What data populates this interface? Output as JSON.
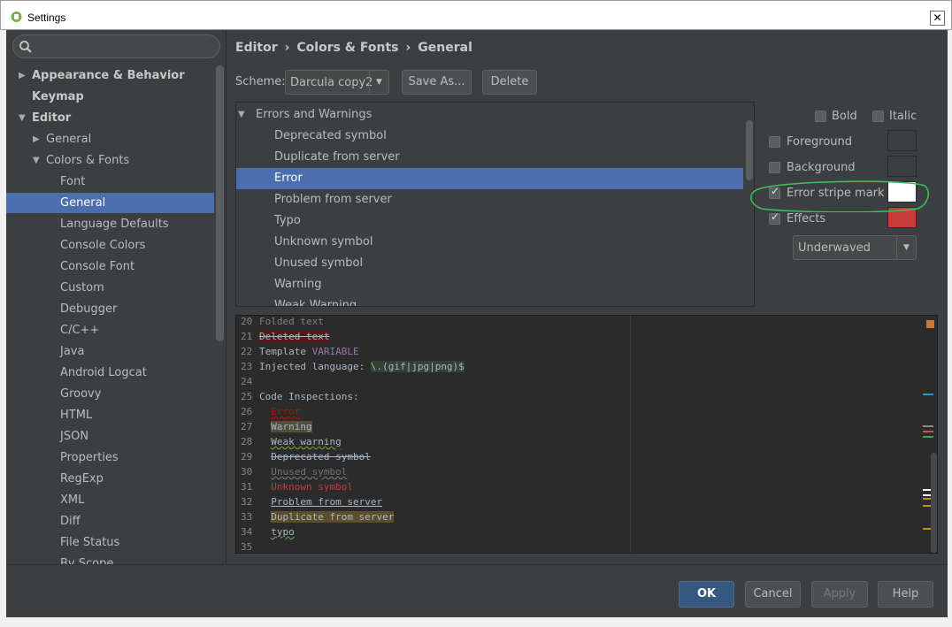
{
  "window": {
    "title": "Settings",
    "close_label": "✕"
  },
  "search": {
    "placeholder": ""
  },
  "tree": [
    {
      "label": "Appearance & Behavior",
      "arrow": "▶",
      "bold": true
    },
    {
      "label": "Keymap",
      "arrow": "",
      "bold": true
    },
    {
      "label": "Editor",
      "arrow": "▼",
      "bold": true
    },
    {
      "label": "General",
      "arrow": "▶"
    },
    {
      "label": "Colors & Fonts",
      "arrow": "▼"
    },
    {
      "label": "Font",
      "arrow": ""
    },
    {
      "label": "General",
      "arrow": "",
      "selected": true
    },
    {
      "label": "Language Defaults",
      "arrow": ""
    },
    {
      "label": "Console Colors",
      "arrow": ""
    },
    {
      "label": "Console Font",
      "arrow": ""
    },
    {
      "label": "Custom",
      "arrow": ""
    },
    {
      "label": "Debugger",
      "arrow": ""
    },
    {
      "label": "C/C++",
      "arrow": ""
    },
    {
      "label": "Java",
      "arrow": ""
    },
    {
      "label": "Android Logcat",
      "arrow": ""
    },
    {
      "label": "Groovy",
      "arrow": ""
    },
    {
      "label": "HTML",
      "arrow": ""
    },
    {
      "label": "JSON",
      "arrow": ""
    },
    {
      "label": "Properties",
      "arrow": ""
    },
    {
      "label": "RegExp",
      "arrow": ""
    },
    {
      "label": "XML",
      "arrow": ""
    },
    {
      "label": "Diff",
      "arrow": ""
    },
    {
      "label": "File Status",
      "arrow": ""
    },
    {
      "label": "By Scope",
      "arrow": ""
    }
  ],
  "breadcrumb": {
    "part1": "Editor",
    "sep": "›",
    "part2": "Colors & Fonts",
    "part3": "General"
  },
  "scheme": {
    "label": "Scheme:",
    "value": "Darcula copy2",
    "save_as": "Save As...",
    "delete": "Delete"
  },
  "attributes": {
    "group": "Errors and Warnings",
    "items": [
      "Deprecated symbol",
      "Duplicate from server",
      "Error",
      "Problem from server",
      "Typo",
      "Unknown symbol",
      "Unused symbol",
      "Warning",
      "Weak Warning"
    ],
    "selected": "Error"
  },
  "properties": {
    "bold": {
      "label": "Bold",
      "checked": false
    },
    "italic": {
      "label": "Italic",
      "checked": false
    },
    "foreground": {
      "label": "Foreground",
      "checked": false
    },
    "background": {
      "label": "Background",
      "checked": false
    },
    "error_stripe": {
      "label": "Error stripe mark",
      "checked": true,
      "color": "#ffffff"
    },
    "effects": {
      "label": "Effects",
      "checked": true,
      "color": "#c93b3b"
    },
    "effect_type": "Underwaved"
  },
  "preview": {
    "lines": [
      {
        "num": "20",
        "text": "Folded text"
      },
      {
        "num": "21",
        "text": "Deleted text"
      },
      {
        "num": "22",
        "text": "Template ",
        "var": "VARIABLE"
      },
      {
        "num": "23",
        "text": "Injected language: ",
        "inj": "\\.(gif|jpg|png)$"
      },
      {
        "num": "24",
        "text": ""
      },
      {
        "num": "25",
        "text": "Code Inspections:"
      },
      {
        "num": "26",
        "text": "  Error"
      },
      {
        "num": "27",
        "text": "  Warning"
      },
      {
        "num": "28",
        "text": "  Weak warning"
      },
      {
        "num": "29",
        "text": "  Deprecated symbol"
      },
      {
        "num": "30",
        "text": "  Unused symbol"
      },
      {
        "num": "31",
        "text": "  Unknown symbol"
      },
      {
        "num": "32",
        "text": "  Problem from server"
      },
      {
        "num": "33",
        "text": "  Duplicate from server"
      },
      {
        "num": "34",
        "text": "  typo"
      },
      {
        "num": "35",
        "text": ""
      }
    ]
  },
  "footer": {
    "ok": "OK",
    "cancel": "Cancel",
    "apply": "Apply",
    "help": "Help"
  },
  "colors": {
    "accent": "#4b6eaf",
    "background": "#3c3f41",
    "editor_bg": "#2b2b2b",
    "ok_button": "#365880"
  }
}
